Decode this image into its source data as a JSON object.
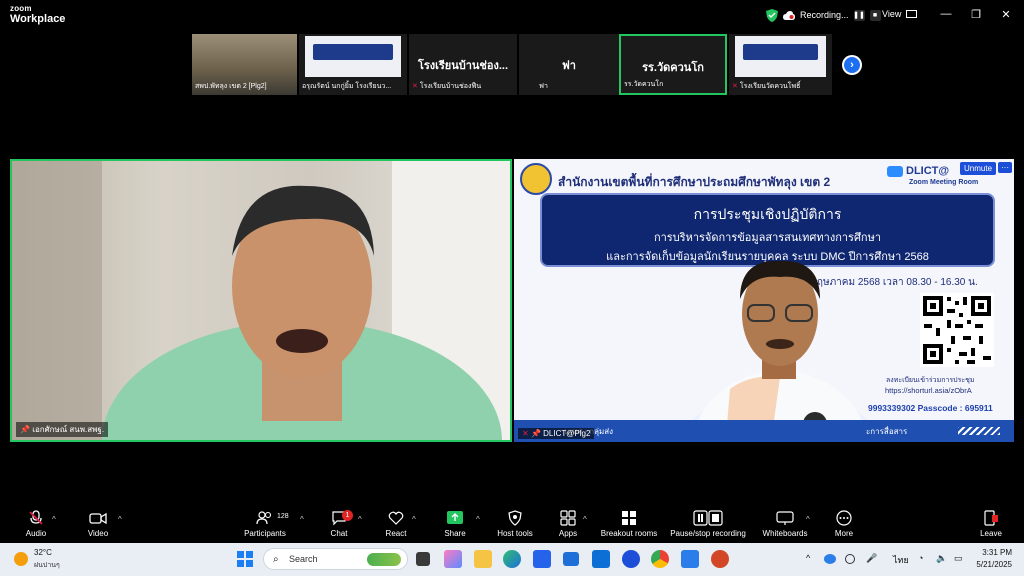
{
  "app": {
    "brand_top": "zoom",
    "brand_bottom": "Workplace"
  },
  "titlebar": {
    "recording_label": "Recording...",
    "view_label": "View"
  },
  "thumbnails": [
    {
      "name": "สพป.พัทลุง เขต 2 [Plg2]",
      "kind": "video"
    },
    {
      "name": "อรุณรัตน์ นกกู่ยิ้ม โรงเรียนว...",
      "kind": "slide"
    },
    {
      "name": "โรงเรียนบ้านช่องฟืน",
      "display": "โรงเรียนบ้านช่อง...",
      "kind": "name"
    },
    {
      "name": "ฟา",
      "display": "ฟา",
      "kind": "name"
    },
    {
      "name": "รร.วัดควนโก",
      "display": "รร.วัดควนโก",
      "kind": "name",
      "active": true
    },
    {
      "name": "โรงเรียนวัดควนโพธิ์",
      "kind": "slide"
    }
  ],
  "speaker": {
    "name": "เอกศักษณ์ สนพ.สพฐ."
  },
  "share": {
    "org_title": "สำนักงานเขตพื้นที่การศึกษาประถมศึกษาพัทลุง เขต 2",
    "dlict": "DLICT@",
    "zoom_room": "Zoom Meeting Room",
    "unmute": "Unmute",
    "more": "···",
    "banner_1": "การประชุมเชิงปฏิบัติการ",
    "banner_2": "การบริหารจัดการข้อมูลสารสนเทศทางการศึกษา",
    "banner_3": "และการจัดเก็บข้อมูลนักเรียนรายบุคคล ระบบ DMC ปีการศึกษา 2568",
    "date_line": "1 พฤษภาคม 2568 เวลา 08.30 - 16.30 น.",
    "register_1": "ลงทะเบียนเข้าร่วมการประชุม",
    "register_2": "https://shorturl.asia/zObrA",
    "meeting_line": "9993339302  Passcode : 695911",
    "footer_left": "นเทศ : กลุ่มส่ง",
    "footer_right": "ะการสื่อสาร",
    "presenter": "DLICT@Plg2"
  },
  "toolbar": {
    "audio": "Audio",
    "video": "Video",
    "participants": "Participants",
    "participants_count": "128",
    "chat": "Chat",
    "chat_badge": "1",
    "react": "React",
    "share": "Share",
    "host_tools": "Host tools",
    "apps": "Apps",
    "breakout": "Breakout rooms",
    "pause_stop": "Pause/stop recording",
    "whiteboards": "Whiteboards",
    "more": "More",
    "leave": "Leave"
  },
  "taskbar": {
    "temp": "32°C",
    "weather": "ฝนปานๆ",
    "search": "Search",
    "lang": "ไทย",
    "time": "3:31 PM",
    "date": "5/21/2025"
  },
  "colors": {
    "active_border": "#22c55e",
    "accent_blue": "#1d6ff2",
    "badge_red": "#e02424"
  }
}
